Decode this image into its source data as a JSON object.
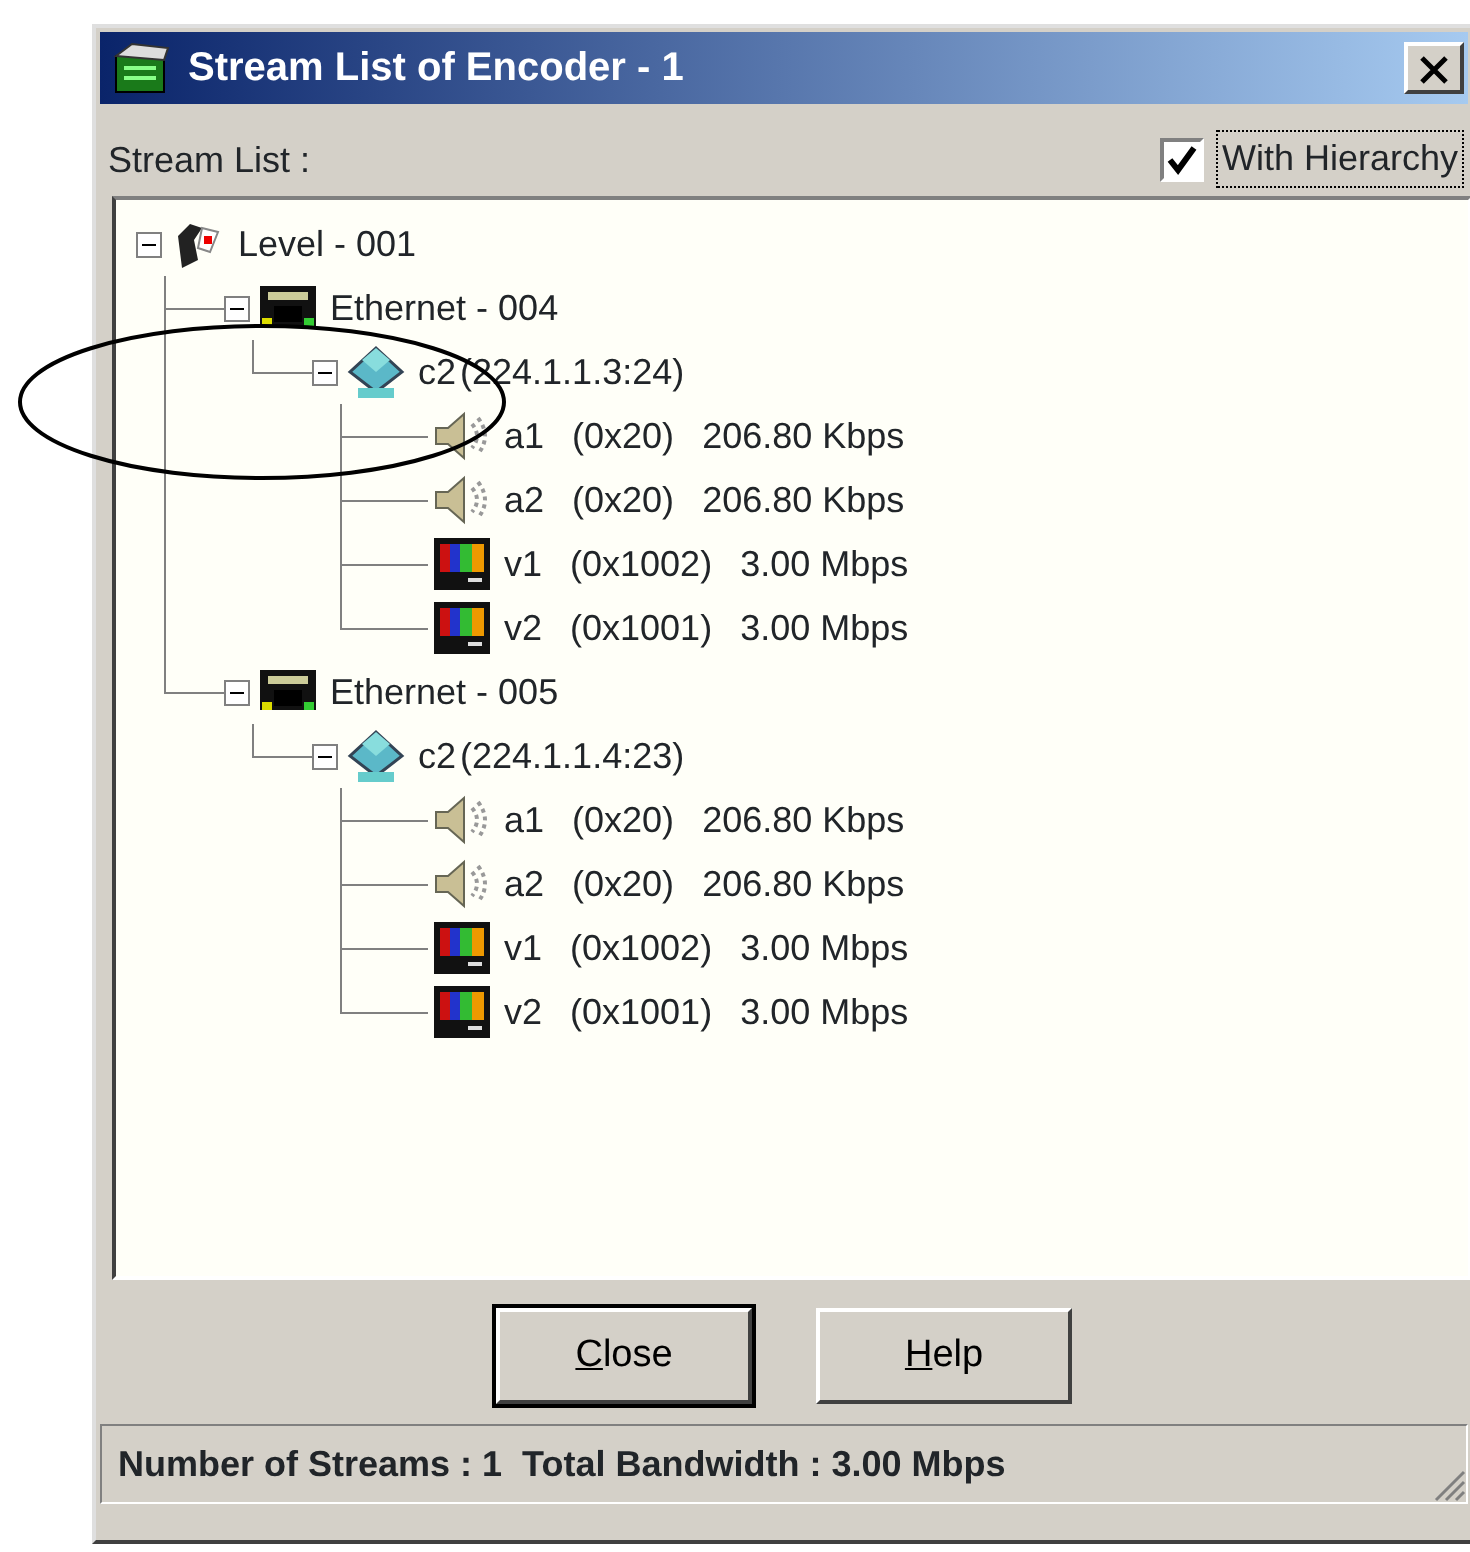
{
  "window": {
    "title": "Stream List of Encoder - 1"
  },
  "header": {
    "label": "Stream List :",
    "hierarchy_checkbox": {
      "label": "With Hierarchy",
      "checked": true
    }
  },
  "tree": [
    {
      "kind": "level",
      "label": "Level - 001",
      "expanded": true,
      "children": [
        {
          "kind": "ethernet",
          "label": "Ethernet - 004",
          "expanded": true,
          "children": [
            {
              "kind": "channel",
              "label": "c2",
              "address": "(224.1.1.3:24)",
              "expanded": true,
              "children": [
                {
                  "kind": "audio",
                  "name": "a1",
                  "pid": "(0x20)",
                  "rate": "206.80 Kbps"
                },
                {
                  "kind": "audio",
                  "name": "a2",
                  "pid": "(0x20)",
                  "rate": "206.80 Kbps"
                },
                {
                  "kind": "video",
                  "name": "v1",
                  "pid": "(0x1002)",
                  "rate": "3.00 Mbps"
                },
                {
                  "kind": "video",
                  "name": "v2",
                  "pid": "(0x1001)",
                  "rate": "3.00 Mbps"
                }
              ]
            }
          ]
        },
        {
          "kind": "ethernet",
          "label": "Ethernet - 005",
          "expanded": true,
          "children": [
            {
              "kind": "channel",
              "label": "c2",
              "address": "(224.1.1.4:23)",
              "expanded": true,
              "children": [
                {
                  "kind": "audio",
                  "name": "a1",
                  "pid": "(0x20)",
                  "rate": "206.80 Kbps"
                },
                {
                  "kind": "audio",
                  "name": "a2",
                  "pid": "(0x20)",
                  "rate": "206.80 Kbps"
                },
                {
                  "kind": "video",
                  "name": "v1",
                  "pid": "(0x1002)",
                  "rate": "3.00 Mbps"
                },
                {
                  "kind": "video",
                  "name": "v2",
                  "pid": "(0x1001)",
                  "rate": "3.00 Mbps"
                }
              ]
            }
          ]
        }
      ]
    }
  ],
  "buttons": [
    {
      "label": "Close",
      "default": true
    },
    {
      "label": "Help",
      "default": false
    }
  ],
  "status_bar": "Number of Streams : 1  Total Bandwidth : 3.00 Mbps",
  "annotations": [
    {
      "kind": "ellipse"
    }
  ]
}
